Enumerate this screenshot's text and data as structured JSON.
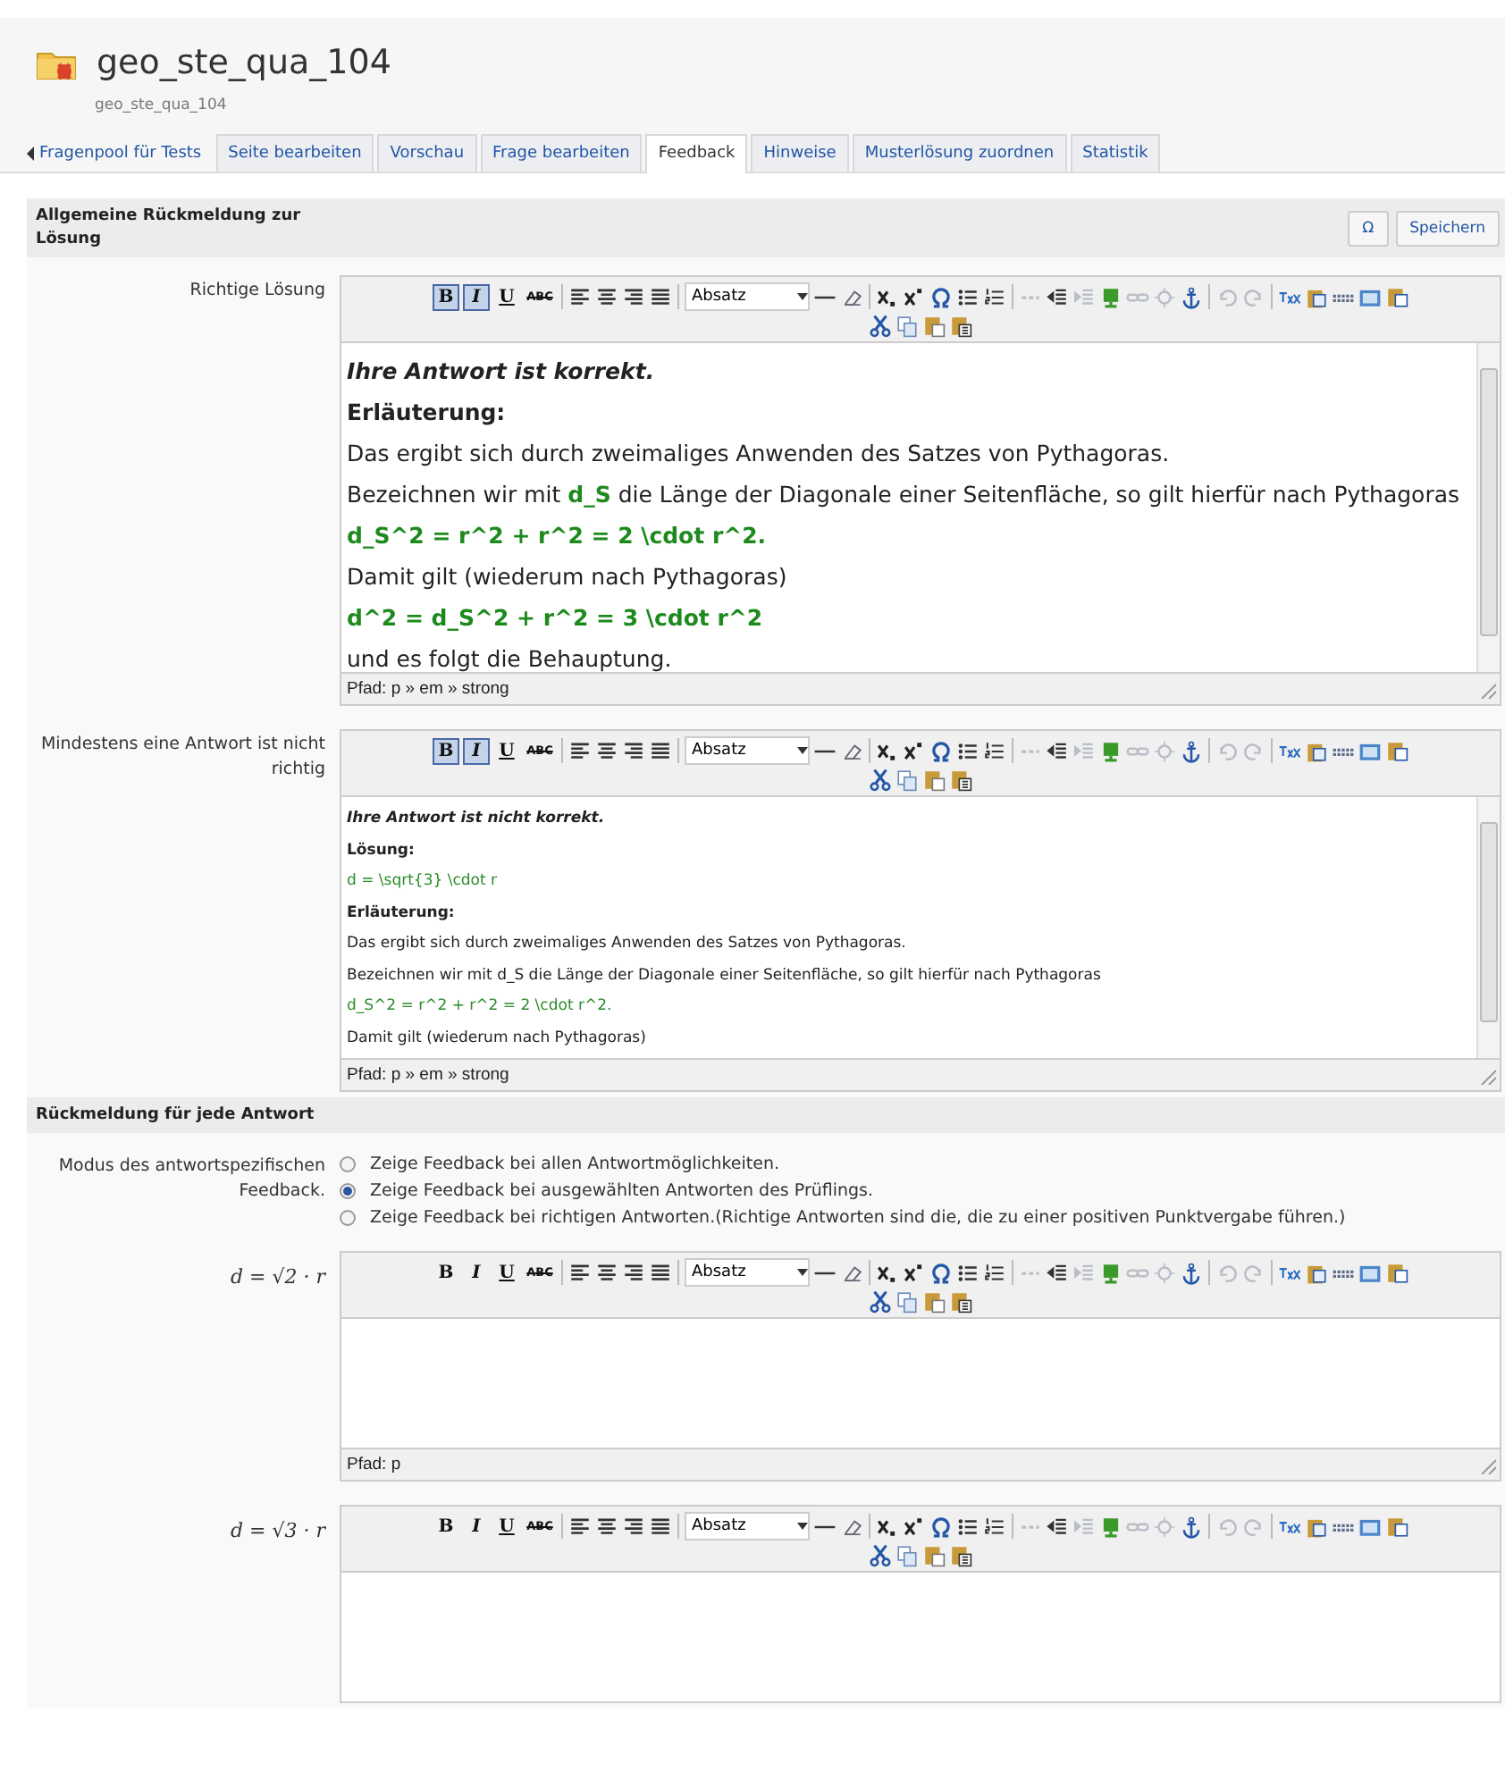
{
  "header": {
    "title": "geo_ste_qua_104",
    "subtitle": "geo_ste_qua_104"
  },
  "back_link": "Fragenpool für Tests",
  "tabs": [
    {
      "label": "Seite bearbeiten",
      "selected": false
    },
    {
      "label": "Vorschau",
      "selected": false
    },
    {
      "label": "Frage bearbeiten",
      "selected": false
    },
    {
      "label": "Feedback",
      "selected": true
    },
    {
      "label": "Hinweise",
      "selected": false
    },
    {
      "label": "Musterlösung zuordnen",
      "selected": false
    },
    {
      "label": "Statistik",
      "selected": false
    }
  ],
  "sections": [
    {
      "title": "Allgemeine Rückmeldung zur Lösung",
      "buttons": [
        "Ω",
        "Speichern"
      ],
      "rows": [
        {
          "kind": "editor",
          "label": "Richtige Lösung",
          "editor": {
            "format_buttons": [
              {
                "label": "B",
                "kind": "bold",
                "active": true
              },
              {
                "label": "I",
                "kind": "italic",
                "active": true
              },
              {
                "label": "U",
                "kind": "underline",
                "active": false
              },
              {
                "label": "ABC",
                "kind": "strike",
                "active": false
              }
            ],
            "block_format": "Absatz",
            "lines": [
              {
                "kind": "title",
                "text": "Ihre Antwort ist korrekt."
              },
              {
                "kind": "heading",
                "text": "Erläuterung:"
              },
              {
                "kind": "text",
                "text": "Das ergibt sich durch zweimaliges Anwenden des Satzes von Pythagoras."
              },
              {
                "kind": "text",
                "text": "Bezeichnen wir mit **d_S** die Länge der Diagonale einer Seitenfläche, so gilt hierfür nach Pythagoras"
              },
              {
                "kind": "formula",
                "text": "d_S^2 = r^2 + r^2 = 2 \\cdot r^2."
              },
              {
                "kind": "text",
                "text": "Damit gilt (wiederum nach Pythagoras)"
              },
              {
                "kind": "formula",
                "text": "d^2 = d_S^2 + r^2 = 3 \\cdot r^2"
              },
              {
                "kind": "text",
                "text": "und es folgt die Behauptung."
              }
            ],
            "path": "Pfad: p » em » strong"
          }
        },
        {
          "kind": "editor",
          "label": "Mindestens eine Antwort ist nicht richtig",
          "editor": {
            "format_buttons": [
              {
                "label": "B",
                "kind": "bold",
                "active": true
              },
              {
                "label": "I",
                "kind": "italic",
                "active": true
              },
              {
                "label": "U",
                "kind": "underline",
                "active": false
              },
              {
                "label": "ABC",
                "kind": "strike",
                "active": false
              }
            ],
            "block_format": "Absatz",
            "lines": [
              {
                "kind": "title",
                "text": "Ihre Antwort ist nicht korrekt."
              },
              {
                "kind": "heading",
                "text": "Lösung:"
              },
              {
                "kind": "code",
                "text": "d = \\sqrt{3} \\cdot r"
              },
              {
                "kind": "heading",
                "text": "Erläuterung:"
              },
              {
                "kind": "text",
                "text": "Das ergibt sich durch zweimaliges Anwenden des Satzes von Pythagoras."
              },
              {
                "kind": "text",
                "text": "Bezeichnen wir mit d_S die Länge der Diagonale einer Seitenfläche, so gilt hierfür nach Pythagoras"
              },
              {
                "kind": "code",
                "text": "d_S^2 = r^2 + r^2 = 2 \\cdot r^2."
              },
              {
                "kind": "text",
                "text": "Damit gilt (wiederum nach Pythagoras)"
              }
            ],
            "path": "Pfad: p » em » strong"
          }
        }
      ]
    },
    {
      "title": "Rückmeldung für jede Antwort",
      "rows": [
        {
          "kind": "radios",
          "label": "Modus des antwortspezifischen Feedback.",
          "options": [
            {
              "label": "Zeige Feedback bei allen Antwortmöglichkeiten.",
              "selected": false
            },
            {
              "label": "Zeige Feedback bei ausgewählten Antworten des Prüflings.",
              "selected": true
            },
            {
              "label": "Zeige Feedback bei richtigen Antworten.(Richtige Antworten sind die, die zu einer positiven Punktvergabe führen.)",
              "selected": false
            }
          ]
        },
        {
          "kind": "answer_editor",
          "label": "d = √2 · r",
          "editor": {
            "format_buttons": [
              {
                "label": "B",
                "kind": "bold",
                "active": false
              },
              {
                "label": "I",
                "kind": "italic",
                "active": false
              },
              {
                "label": "U",
                "kind": "underline",
                "active": false
              },
              {
                "label": "ABC",
                "kind": "strike",
                "active": false
              }
            ],
            "block_format": "Absatz",
            "path": "Pfad: p"
          }
        },
        {
          "kind": "answer_editor",
          "label": "d = √3 · r",
          "editor": {
            "format_buttons": [
              {
                "label": "B",
                "kind": "bold",
                "active": false
              },
              {
                "label": "I",
                "kind": "italic",
                "active": false
              },
              {
                "label": "U",
                "kind": "underline",
                "active": false
              },
              {
                "label": "ABC",
                "kind": "strike",
                "active": false
              }
            ],
            "block_format": "Absatz"
          }
        }
      ]
    }
  ]
}
